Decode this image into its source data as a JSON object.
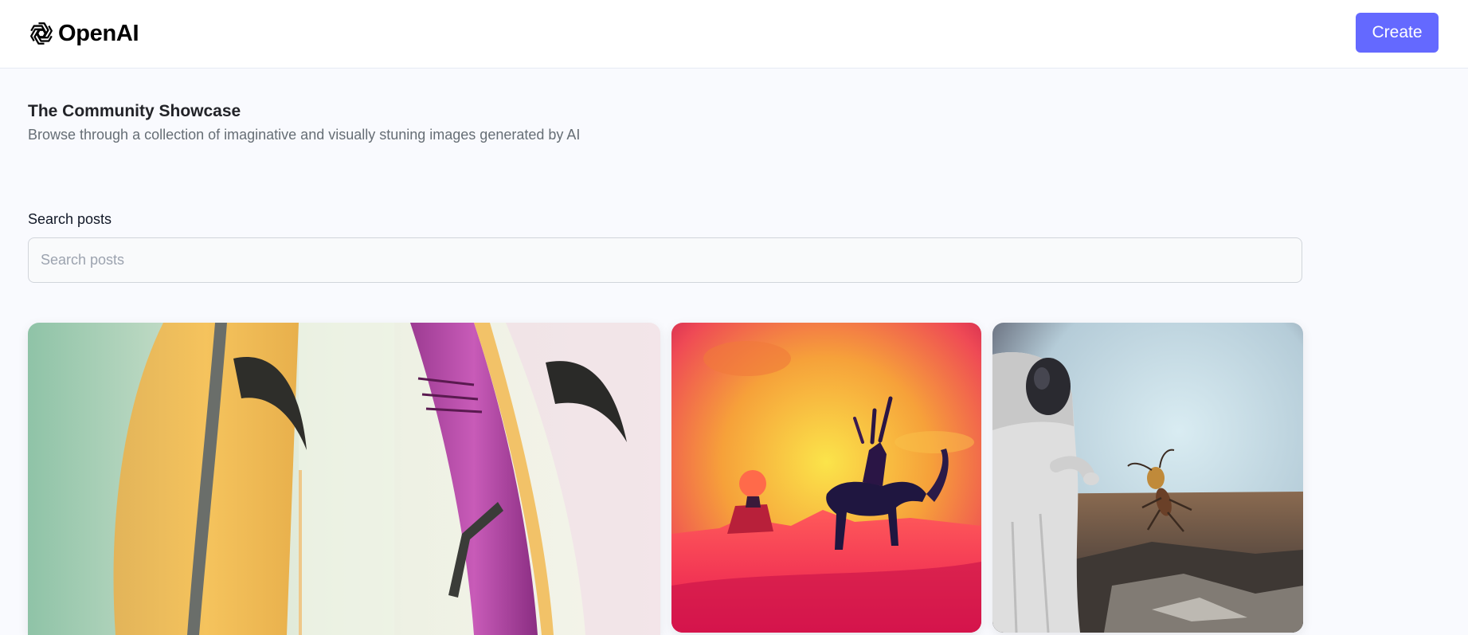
{
  "header": {
    "brand": "OpenAI",
    "create_label": "Create"
  },
  "showcase": {
    "title": "The Community Showcase",
    "subtitle": "Browse through a collection of imaginative and visually stuning images generated by AI"
  },
  "search": {
    "label": "Search posts",
    "placeholder": "Search posts",
    "value": ""
  },
  "posts": [
    {
      "subject": "surfboards"
    },
    {
      "subject": "rider-on-horse-sunset"
    },
    {
      "subject": "astronaut-and-insect"
    }
  ],
  "colors": {
    "accent": "#6469ff",
    "background": "#f9fafe",
    "title": "#222328",
    "subtitle": "#666e75"
  }
}
